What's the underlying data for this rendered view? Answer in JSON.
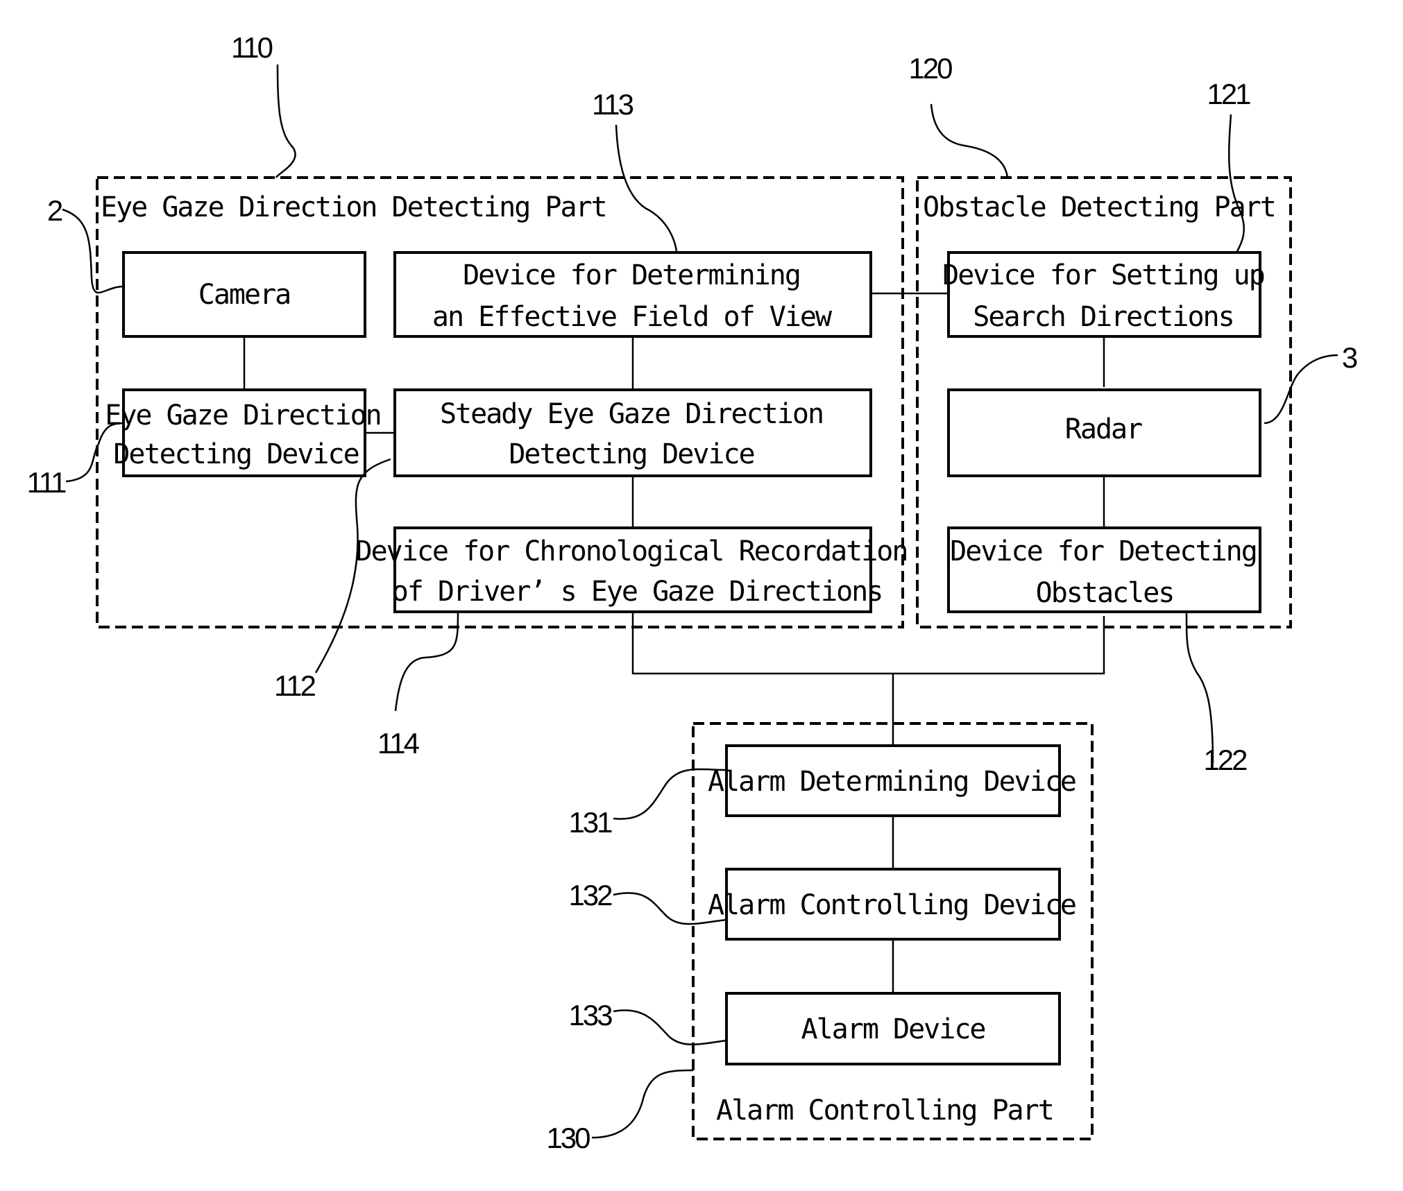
{
  "figure": {
    "groups": {
      "eye_gaze_part": {
        "ref": "110",
        "title": "Eye Gaze Direction Detecting Part"
      },
      "obstacle_part": {
        "ref": "120",
        "title": "Obstacle Detecting Part"
      },
      "alarm_part": {
        "ref": "130",
        "title": "Alarm Controlling Part"
      }
    },
    "blocks": {
      "camera": {
        "ref": "2",
        "lines": [
          "Camera"
        ]
      },
      "eye_gaze_detecting_device": {
        "ref": "111",
        "lines": [
          "Eye Gaze Direction",
          "Detecting Device"
        ]
      },
      "steady_eye_gaze_device": {
        "ref": "112",
        "lines": [
          "Steady Eye Gaze Direction",
          "Detecting Device"
        ]
      },
      "effective_fov_device": {
        "ref": "113",
        "lines": [
          "Device for Determining",
          "an Effective Field of View"
        ]
      },
      "chronological_device": {
        "ref": "114",
        "lines": [
          "Device for Chronological Recordation",
          "of Driver’ s Eye Gaze Directions"
        ]
      },
      "search_directions_device": {
        "ref": "121",
        "lines": [
          "Device for Setting up",
          "Search Directions"
        ]
      },
      "radar": {
        "ref": "3",
        "lines": [
          "Radar"
        ]
      },
      "obstacle_detecting_device": {
        "ref": "122",
        "lines": [
          "Device for Detecting",
          "Obstacles"
        ]
      },
      "alarm_determining_device": {
        "ref": "131",
        "lines": [
          "Alarm Determining Device"
        ]
      },
      "alarm_controlling_device": {
        "ref": "132",
        "lines": [
          "Alarm Controlling Device"
        ]
      },
      "alarm_device": {
        "ref": "133",
        "lines": [
          "Alarm Device"
        ]
      }
    }
  }
}
